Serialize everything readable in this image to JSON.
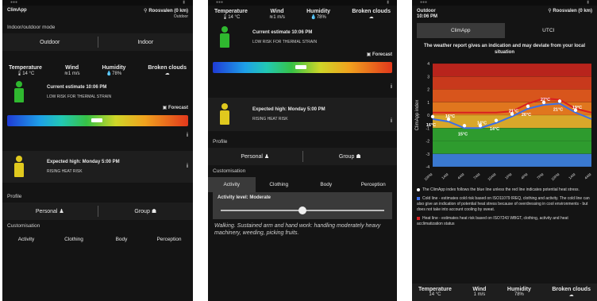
{
  "screen1": {
    "app_name": "ClimApp",
    "location": "Roosvalen (0 km)",
    "env": "Outdoor",
    "mode_label": "Indoor/outdoor mode",
    "mode_outdoor": "Outdoor",
    "mode_indoor": "Indoor",
    "weather": [
      {
        "h": "Temperature",
        "v": "14 °C"
      },
      {
        "h": "Wind",
        "v": "1 m/s"
      },
      {
        "h": "Humidity",
        "v": "78%"
      },
      {
        "h": "Broken clouds",
        "v": ""
      }
    ],
    "estimate_title": "Current estimate 10:06 PM",
    "estimate_sub": "LOW RISK FOR THERMAL STRAIN",
    "forecast": "Forecast",
    "info": "i",
    "expected_title": "Expected high: Monday 5:00 PM",
    "expected_sub": "RISING HEAT RISK",
    "profile_label": "Profile",
    "personal": "Personal",
    "group": "Group",
    "custom_label": "Customisation",
    "tabs": [
      "Activity",
      "Clothing",
      "Body",
      "Perception"
    ]
  },
  "screen2": {
    "weather": [
      {
        "h": "Temperature",
        "v": "14 °C"
      },
      {
        "h": "Wind",
        "v": "1 m/s"
      },
      {
        "h": "Humidity",
        "v": "78%"
      },
      {
        "h": "Broken clouds",
        "v": ""
      }
    ],
    "estimate_title": "Current estimate 10:06 PM",
    "estimate_sub": "LOW RISK FOR THERMAL STRAIN",
    "forecast": "Forecast",
    "info": "i",
    "expected_title": "Expected high: Monday 5:00 PM",
    "expected_sub": "RISING HEAT RISK",
    "profile_label": "Profile",
    "personal": "Personal",
    "group": "Group",
    "custom_label": "Customisation",
    "tabs": [
      "Activity",
      "Clothing",
      "Body",
      "Perception"
    ],
    "activity_level": "Activity level: Moderate",
    "activity_desc": "Walking. Sustained arm and hand work: handling moderately heavy machinery, weeding, picking fruits."
  },
  "screen3": {
    "env": "Outdoor",
    "time": "10:06 PM",
    "location": "Roosvalen (0 km)",
    "tab_climapp": "ClimApp",
    "tab_utci": "UTCI",
    "note": "The weather report gives an indication and may deviate from your local situation",
    "y_axis": "ClimApp index",
    "legend1": "The ClimApp index follows the blue line unless the red line indicates potential heat stress.",
    "legend2": "Cold line - estimates cold risk based on ISO11079 IREQ, clothing and activity. The cold line can also give an indication of potential heat stress because of overdressing in cool environments - but does not take into account cooling by sweat.",
    "legend3": "Heat line - estimates heat risk based on ISO7243 WBGT, clothing, activity and heat acclimatization status",
    "bottom": [
      {
        "h": "Temperature",
        "v": "14 °C"
      },
      {
        "h": "Wind",
        "v": "1 m/s"
      },
      {
        "h": "Humidity",
        "v": "78%"
      },
      {
        "h": "Broken clouds",
        "v": ""
      }
    ],
    "chart_data": {
      "type": "line",
      "ylabel": "ClimApp index",
      "ylim": [
        -4,
        4
      ],
      "yticks": [
        4,
        3,
        2,
        1,
        0,
        -1,
        -2,
        -3,
        -4
      ],
      "x": [
        "10PM",
        "1AM",
        "4AM",
        "7AM",
        "10AM",
        "1PM",
        "4PM",
        "7PM",
        "10PM",
        "1AM",
        "4AM"
      ],
      "series": [
        {
          "name": "Cold line",
          "color": "#3b6fe8",
          "values": [
            -0.3,
            -0.5,
            -1.0,
            -1.0,
            -0.6,
            -0.1,
            0.5,
            0.8,
            0.9,
            0.2,
            -0.3
          ]
        },
        {
          "name": "Heat line",
          "color": "#d82020",
          "values": [
            0.2,
            0.2,
            0.2,
            0.2,
            0.2,
            0.3,
            0.9,
            1.3,
            1.2,
            0.5,
            0.2
          ]
        }
      ],
      "point_labels": [
        "16°C",
        "16°C",
        "15°C",
        "14°C",
        "14°C",
        "21°C",
        "26°C",
        "27°C",
        "21°C",
        "19°C"
      ]
    },
    "colors": {
      "cold": "#3b6fe8",
      "heat": "#d82020",
      "info": "#ffffff"
    }
  }
}
